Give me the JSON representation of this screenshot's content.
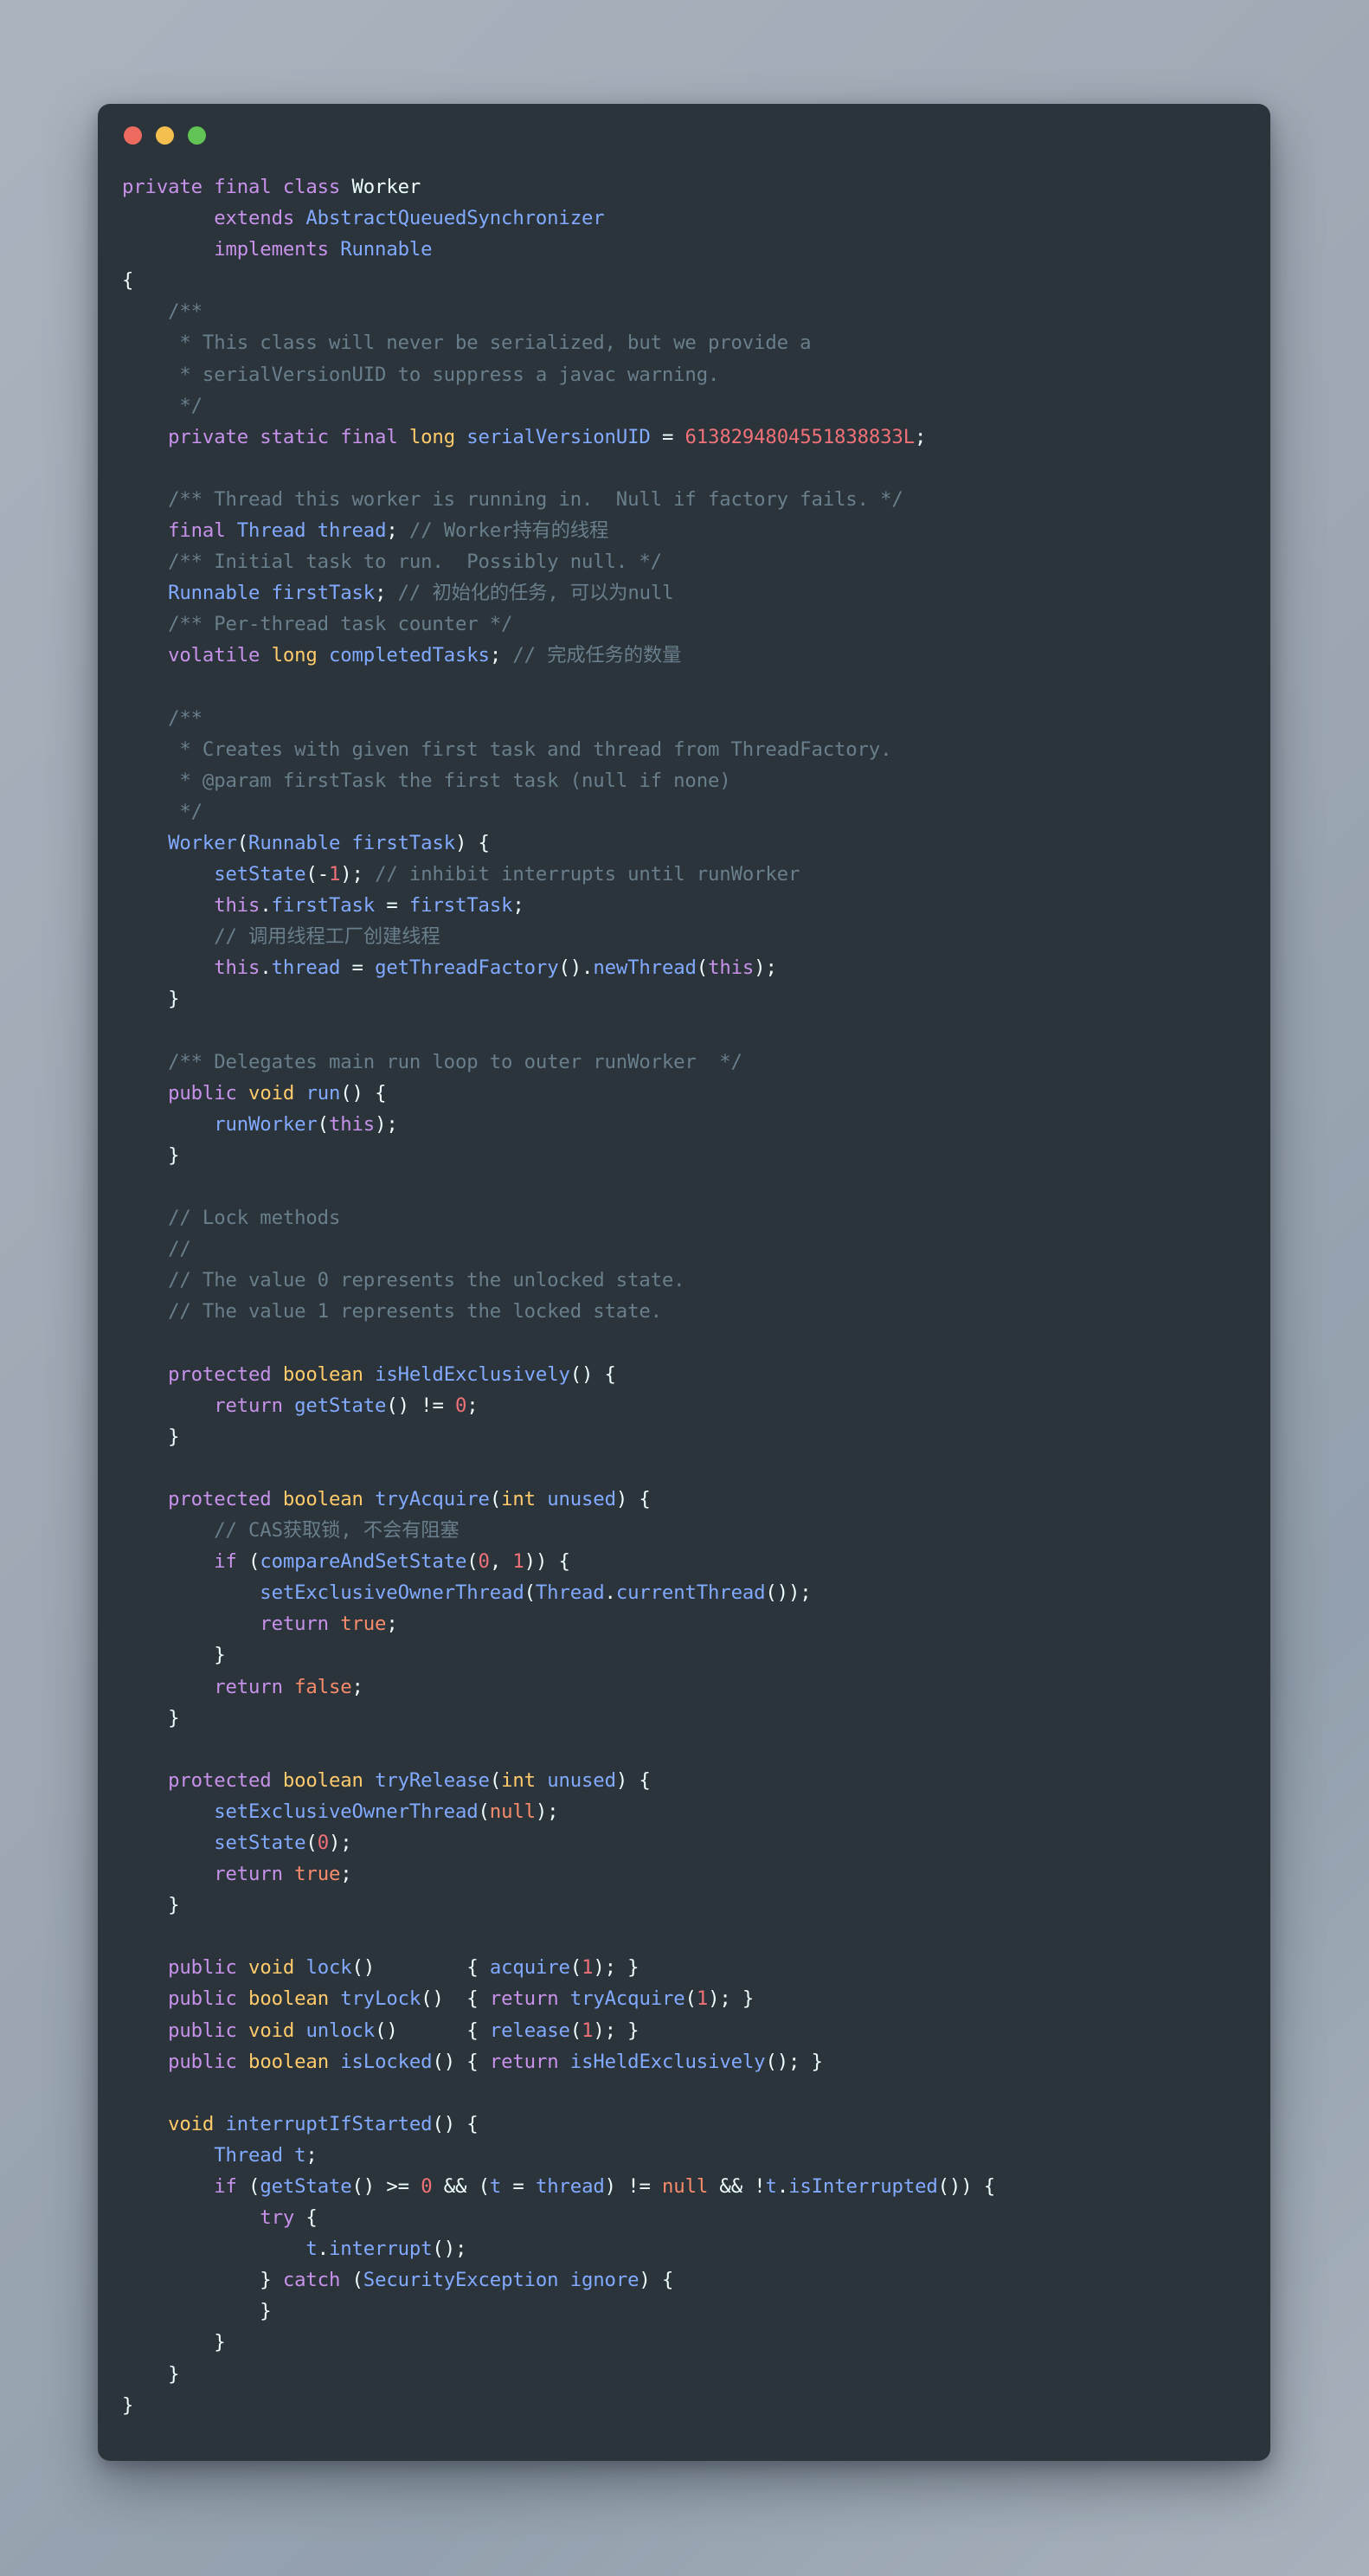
{
  "window": {
    "traffic_lights": [
      {
        "name": "close",
        "color": "#ec6a5e"
      },
      {
        "name": "minimize",
        "color": "#f4bf4f"
      },
      {
        "name": "zoom",
        "color": "#61c454"
      }
    ],
    "background_gradient": [
      "#aab4bf",
      "#93a0ad"
    ],
    "editor_background": "#2b333b"
  },
  "theme": {
    "keyword": "#c792ea",
    "type": "#82aaff",
    "class_name": "#eeffff",
    "primitive": "#ffcb6b",
    "number": "#f07178",
    "literal": "#f78c6c",
    "comment": "#697f8c",
    "punctuation": "#eeffff"
  },
  "code": {
    "language": "java",
    "lines": [
      "private final class Worker",
      "        extends AbstractQueuedSynchronizer",
      "        implements Runnable",
      "{",
      "    /**",
      "     * This class will never be serialized, but we provide a",
      "     * serialVersionUID to suppress a javac warning.",
      "     */",
      "    private static final long serialVersionUID = 6138294804551838833L;",
      "",
      "    /** Thread this worker is running in.  Null if factory fails. */",
      "    final Thread thread; // Worker持有的线程",
      "    /** Initial task to run.  Possibly null. */",
      "    Runnable firstTask; // 初始化的任务, 可以为null",
      "    /** Per-thread task counter */",
      "    volatile long completedTasks; // 完成任务的数量",
      "",
      "    /**",
      "     * Creates with given first task and thread from ThreadFactory.",
      "     * @param firstTask the first task (null if none)",
      "     */",
      "    Worker(Runnable firstTask) {",
      "        setState(-1); // inhibit interrupts until runWorker",
      "        this.firstTask = firstTask;",
      "        // 调用线程工厂创建线程",
      "        this.thread = getThreadFactory().newThread(this);",
      "    }",
      "",
      "    /** Delegates main run loop to outer runWorker  */",
      "    public void run() {",
      "        runWorker(this);",
      "    }",
      "",
      "    // Lock methods",
      "    //",
      "    // The value 0 represents the unlocked state.",
      "    // The value 1 represents the locked state.",
      "",
      "    protected boolean isHeldExclusively() {",
      "        return getState() != 0;",
      "    }",
      "",
      "    protected boolean tryAcquire(int unused) {",
      "        // CAS获取锁, 不会有阻塞",
      "        if (compareAndSetState(0, 1)) {",
      "            setExclusiveOwnerThread(Thread.currentThread());",
      "            return true;",
      "        }",
      "        return false;",
      "    }",
      "",
      "    protected boolean tryRelease(int unused) {",
      "        setExclusiveOwnerThread(null);",
      "        setState(0);",
      "        return true;",
      "    }",
      "",
      "    public void lock()        { acquire(1); }",
      "    public boolean tryLock()  { return tryAcquire(1); }",
      "    public void unlock()      { release(1); }",
      "    public boolean isLocked() { return isHeldExclusively(); }",
      "",
      "    void interruptIfStarted() {",
      "        Thread t;",
      "        if (getState() >= 0 && (t = thread) != null && !t.isInterrupted()) {",
      "            try {",
      "                t.interrupt();",
      "            } catch (SecurityException ignore) {",
      "            }",
      "        }",
      "    }",
      "}"
    ],
    "html": "<span class=\"kw\">private final class</span> <span class=\"cls\">Worker</span>\n        <span class=\"kw\">extends</span> <span class=\"typ\">AbstractQueuedSynchronizer</span>\n        <span class=\"kw\">implements</span> <span class=\"typ\">Runnable</span>\n<span class=\"pun\">{</span>\n    <span class=\"cmt\">/**</span>\n     <span class=\"cmt\">* This class will never be serialized, but we provide a</span>\n     <span class=\"cmt\">* serialVersionUID to suppress a javac warning.</span>\n     <span class=\"cmt\">*/</span>\n    <span class=\"kw\">private static final</span> <span class=\"prim\">long</span> <span class=\"typ\">serialVersionUID</span> <span class=\"pun\">=</span> <span class=\"num\">6138294804551838833L</span><span class=\"pun\">;</span>\n\n    <span class=\"cmt\">/** Thread this worker is running in.  Null if factory fails. */</span>\n    <span class=\"kw\">final</span> <span class=\"typ\">Thread</span> <span class=\"typ\">thread</span><span class=\"pun\">;</span> <span class=\"cmt\">// Worker持有的线程</span>\n    <span class=\"cmt\">/** Initial task to run.  Possibly null. */</span>\n    <span class=\"typ\">Runnable</span> <span class=\"typ\">firstTask</span><span class=\"pun\">;</span> <span class=\"cmt\">// 初始化的任务, 可以为null</span>\n    <span class=\"cmt\">/** Per-thread task counter */</span>\n    <span class=\"kw\">volatile</span> <span class=\"prim\">long</span> <span class=\"typ\">completedTasks</span><span class=\"pun\">;</span> <span class=\"cmt\">// 完成任务的数量</span>\n\n    <span class=\"cmt\">/**</span>\n     <span class=\"cmt\">* Creates with given first task and thread from ThreadFactory.</span>\n     <span class=\"cmt\">* @param firstTask the first task (null if none)</span>\n     <span class=\"cmt\">*/</span>\n    <span class=\"typ\">Worker</span><span class=\"pun\">(</span><span class=\"typ\">Runnable</span> <span class=\"typ\">firstTask</span><span class=\"pun\">) {</span>\n        <span class=\"typ\">setState</span><span class=\"pun\">(</span><span class=\"pun\">-</span><span class=\"num\">1</span><span class=\"pun\">);</span> <span class=\"cmt\">// inhibit interrupts until runWorker</span>\n        <span class=\"kw\">this</span><span class=\"pun\">.</span><span class=\"typ\">firstTask</span> <span class=\"pun\">=</span> <span class=\"typ\">firstTask</span><span class=\"pun\">;</span>\n        <span class=\"cmt\">// 调用线程工厂创建线程</span>\n        <span class=\"kw\">this</span><span class=\"pun\">.</span><span class=\"typ\">thread</span> <span class=\"pun\">=</span> <span class=\"typ\">getThreadFactory</span><span class=\"pun\">().</span><span class=\"typ\">newThread</span><span class=\"pun\">(</span><span class=\"kw\">this</span><span class=\"pun\">);</span>\n    <span class=\"pun\">}</span>\n\n    <span class=\"cmt\">/** Delegates main run loop to outer runWorker  */</span>\n    <span class=\"kw\">public</span> <span class=\"prim\">void</span> <span class=\"typ\">run</span><span class=\"pun\">() {</span>\n        <span class=\"typ\">runWorker</span><span class=\"pun\">(</span><span class=\"kw\">this</span><span class=\"pun\">);</span>\n    <span class=\"pun\">}</span>\n\n    <span class=\"cmt\">// Lock methods</span>\n    <span class=\"cmt\">//</span>\n    <span class=\"cmt\">// The value 0 represents the unlocked state.</span>\n    <span class=\"cmt\">// The value 1 represents the locked state.</span>\n\n    <span class=\"kw\">protected</span> <span class=\"prim\">boolean</span> <span class=\"typ\">isHeldExclusively</span><span class=\"pun\">() {</span>\n        <span class=\"kw\">return</span> <span class=\"typ\">getState</span><span class=\"pun\">() !=</span> <span class=\"num\">0</span><span class=\"pun\">;</span>\n    <span class=\"pun\">}</span>\n\n    <span class=\"kw\">protected</span> <span class=\"prim\">boolean</span> <span class=\"typ\">tryAcquire</span><span class=\"pun\">(</span><span class=\"prim\">int</span> <span class=\"typ\">unused</span><span class=\"pun\">) {</span>\n        <span class=\"cmt\">// CAS获取锁, 不会有阻塞</span>\n        <span class=\"kw\">if</span> <span class=\"pun\">(</span><span class=\"typ\">compareAndSetState</span><span class=\"pun\">(</span><span class=\"num\">0</span><span class=\"pun\">,</span> <span class=\"num\">1</span><span class=\"pun\">)) {</span>\n            <span class=\"typ\">setExclusiveOwnerThread</span><span class=\"pun\">(</span><span class=\"typ\">Thread</span><span class=\"pun\">.</span><span class=\"typ\">currentThread</span><span class=\"pun\">());</span>\n            <span class=\"kw\">return</span> <span class=\"lit\">true</span><span class=\"pun\">;</span>\n        <span class=\"pun\">}</span>\n        <span class=\"kw\">return</span> <span class=\"lit\">false</span><span class=\"pun\">;</span>\n    <span class=\"pun\">}</span>\n\n    <span class=\"kw\">protected</span> <span class=\"prim\">boolean</span> <span class=\"typ\">tryRelease</span><span class=\"pun\">(</span><span class=\"prim\">int</span> <span class=\"typ\">unused</span><span class=\"pun\">) {</span>\n        <span class=\"typ\">setExclusiveOwnerThread</span><span class=\"pun\">(</span><span class=\"lit\">null</span><span class=\"pun\">);</span>\n        <span class=\"typ\">setState</span><span class=\"pun\">(</span><span class=\"num\">0</span><span class=\"pun\">);</span>\n        <span class=\"kw\">return</span> <span class=\"lit\">true</span><span class=\"pun\">;</span>\n    <span class=\"pun\">}</span>\n\n    <span class=\"kw\">public</span> <span class=\"prim\">void</span> <span class=\"typ\">lock</span><span class=\"pun\">()</span>        <span class=\"pun\">{</span> <span class=\"typ\">acquire</span><span class=\"pun\">(</span><span class=\"num\">1</span><span class=\"pun\">); }</span>\n    <span class=\"kw\">public</span> <span class=\"prim\">boolean</span> <span class=\"typ\">tryLock</span><span class=\"pun\">()</span>  <span class=\"pun\">{</span> <span class=\"kw\">return</span> <span class=\"typ\">tryAcquire</span><span class=\"pun\">(</span><span class=\"num\">1</span><span class=\"pun\">); }</span>\n    <span class=\"kw\">public</span> <span class=\"prim\">void</span> <span class=\"typ\">unlock</span><span class=\"pun\">()</span>      <span class=\"pun\">{</span> <span class=\"typ\">release</span><span class=\"pun\">(</span><span class=\"num\">1</span><span class=\"pun\">); }</span>\n    <span class=\"kw\">public</span> <span class=\"prim\">boolean</span> <span class=\"typ\">isLocked</span><span class=\"pun\">()</span> <span class=\"pun\">{</span> <span class=\"kw\">return</span> <span class=\"typ\">isHeldExclusively</span><span class=\"pun\">(); }</span>\n\n    <span class=\"prim\">void</span> <span class=\"typ\">interruptIfStarted</span><span class=\"pun\">() {</span>\n        <span class=\"typ\">Thread</span> <span class=\"typ\">t</span><span class=\"pun\">;</span>\n        <span class=\"kw\">if</span> <span class=\"pun\">(</span><span class=\"typ\">getState</span><span class=\"pun\">() &gt;=</span> <span class=\"num\">0</span> <span class=\"pun\">&amp;&amp; (</span><span class=\"typ\">t</span> <span class=\"pun\">=</span> <span class=\"typ\">thread</span><span class=\"pun\">) !=</span> <span class=\"lit\">null</span> <span class=\"pun\">&amp;&amp; !</span><span class=\"typ\">t</span><span class=\"pun\">.</span><span class=\"typ\">isInterrupted</span><span class=\"pun\">()) {</span>\n            <span class=\"kw\">try</span> <span class=\"pun\">{</span>\n                <span class=\"typ\">t</span><span class=\"pun\">.</span><span class=\"typ\">interrupt</span><span class=\"pun\">();</span>\n            <span class=\"pun\">}</span> <span class=\"kw\">catch</span> <span class=\"pun\">(</span><span class=\"typ\">SecurityException</span> <span class=\"typ\">ignore</span><span class=\"pun\">) {</span>\n            <span class=\"pun\">}</span>\n        <span class=\"pun\">}</span>\n    <span class=\"pun\">}</span>\n<span class=\"pun\">}</span>"
  }
}
